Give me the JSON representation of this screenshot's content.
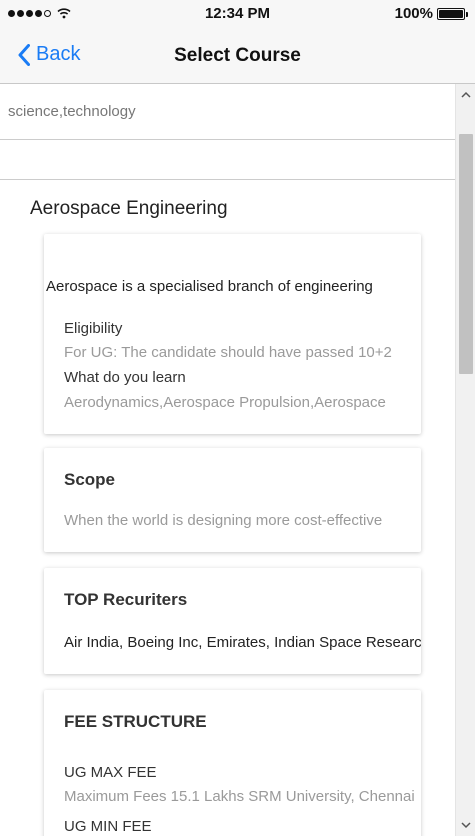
{
  "status_bar": {
    "time": "12:34 PM",
    "battery": "100%",
    "signal_icon": "signal-dots-icon",
    "wifi_icon": "wifi-icon",
    "battery_icon": "battery-icon"
  },
  "nav": {
    "back_label": "Back",
    "back_icon": "chevron-left-icon",
    "title": "Select Course",
    "accent_color": "#1a7cf5"
  },
  "search": {
    "value": "science,technology"
  },
  "course": {
    "title": "Aerospace Engineering"
  },
  "intro_card": {
    "description": "Aerospace is a specialised branch of engineering",
    "eligibility_label": "Eligibility",
    "eligibility_text": "For UG: The candidate should have passed 10+2",
    "learn_label": "What do you learn",
    "learn_text": "Aerodynamics,Aerospace Propulsion,Aerospace"
  },
  "scope_card": {
    "heading": "Scope",
    "text": "When the world is designing more cost-effective"
  },
  "recruiters_card": {
    "heading": "TOP Recuriters",
    "text": "Air India, Boeing Inc, Emirates, Indian Space Research"
  },
  "fee_card": {
    "heading": "FEE STRUCTURE",
    "ug_max_label": "UG MAX FEE",
    "ug_max_text": "Maximum Fees 15.1 Lakhs SRM University, Chennai",
    "ug_min_label": "UG MIN FEE"
  },
  "scrollbar": {
    "up_icon": "chevron-up-icon",
    "down_icon": "chevron-down-icon"
  }
}
